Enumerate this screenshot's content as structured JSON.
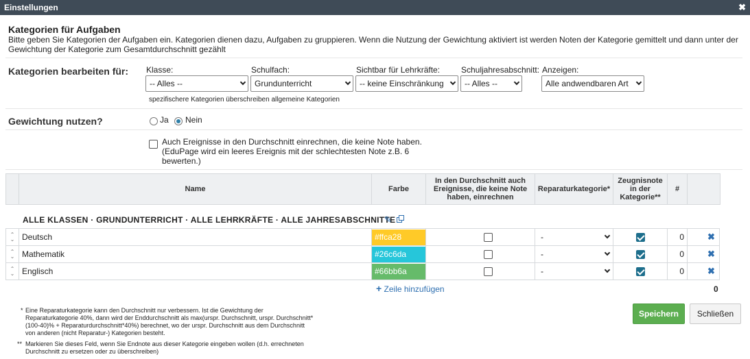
{
  "window": {
    "title": "Einstellungen",
    "close_glyph": "✖"
  },
  "intro": {
    "heading": "Kategorien für Aufgaben",
    "line1": "Bitte geben Sie Kategorien der Aufgaben ein. Kategorien dienen dazu, Aufgaben zu gruppieren. Wenn die Nutzung der Gewichtung aktiviert ist werden Noten der Kategorie gemittelt und dann unter der",
    "line2": "Gewichtung der Kategorie zum Gesamtdurchschnitt gezählt"
  },
  "filters": {
    "section_label": "Kategorien bearbeiten für:",
    "klasse": {
      "label": "Klasse:",
      "value": "-- Alles --"
    },
    "schulfach": {
      "label": "Schulfach:",
      "value": "Grundunterricht"
    },
    "lehrkraefte": {
      "label": "Sichtbar für Lehrkräfte:",
      "value": "-- keine Einschränkung"
    },
    "abschnitt": {
      "label": "Schuljahresabschnitt:",
      "value": "-- Alles --"
    },
    "anzeigen": {
      "label": "Anzeigen:",
      "value": "Alle andwendbaren Art"
    },
    "note": "spezifischere Kategorien überschreiben allgemeine Kategorien"
  },
  "weighting": {
    "label": "Gewichtung nutzen?",
    "yes": "Ja",
    "no": "Nein",
    "selected": "Nein",
    "events_line1": "Auch Ereignisse in den Durchschnitt einrechnen, die keine Note haben.",
    "events_line2": "(EduPage wird ein leeres Ereignis mit der schlechtesten Note z.B. 6",
    "events_line3": "bewerten.)",
    "events_checked": false
  },
  "table": {
    "headers": {
      "name": "Name",
      "farbe": "Farbe",
      "avg_l1": "In den Durchschnitt auch",
      "avg_l2": "Ereignisse, die keine Note",
      "avg_l3": "haben, einrechnen",
      "repair": "Reparaturkategorie*",
      "grade_l1": "Zeugnisnote",
      "grade_l2": "in der",
      "grade_l3": "Kategorie**",
      "count": "#"
    },
    "group_title": "ALLE KLASSEN · GRUNDUNTERRICHT · ALLE LEHRKRÄFTE · ALLE JAHRESABSCHNITTE",
    "rows": [
      {
        "name": "Deutsch",
        "color": "#ffca28",
        "color_label": "#ffca28",
        "avg_checked": false,
        "repair": "-",
        "grade_checked": true,
        "count": "0"
      },
      {
        "name": "Mathematik",
        "color": "#26c6da",
        "color_label": "#26c6da",
        "avg_checked": false,
        "repair": "-",
        "grade_checked": true,
        "count": "0"
      },
      {
        "name": "Englisch",
        "color": "#66bb6a",
        "color_label": "#66bb6a",
        "avg_checked": false,
        "repair": "-",
        "grade_checked": true,
        "count": "0"
      }
    ],
    "add_row": "Zeile hinzufügen",
    "total_count": "0"
  },
  "footnotes": {
    "star1_mark": "*",
    "star1_l1": "Eine Reparaturkategorie kann den Durchschnitt nur verbessern. Ist die Gewichtung der",
    "star1_l2": "Reparaturkategorie 40%, dann wird der Enddurchschnitt als max(urspr. Durchschnitt, urspr. Durchschnitt*",
    "star1_l3": "(100-40)% + Reparaturdurchschnitt*40%) berechnet, wo der urspr. Durchschnitt aus dem Durchschnitt",
    "star1_l4": "von anderen (nicht Reparatur-) Kategorien besteht.",
    "star2_mark": "**",
    "star2_l1": "Markieren Sie dieses Feld, wenn Sie Endnote aus dieser Kategorie eingeben wollen (d.h. errechneten",
    "star2_l2": "Durchschnitt zu ersetzen oder zu überschreiben)"
  },
  "buttons": {
    "save": "Speichern",
    "close": "Schließen"
  },
  "colors": {
    "titlebar": "#3f4b57",
    "save": "#5cae50",
    "link": "#2e6fb0",
    "check": "#1d6e8c"
  }
}
